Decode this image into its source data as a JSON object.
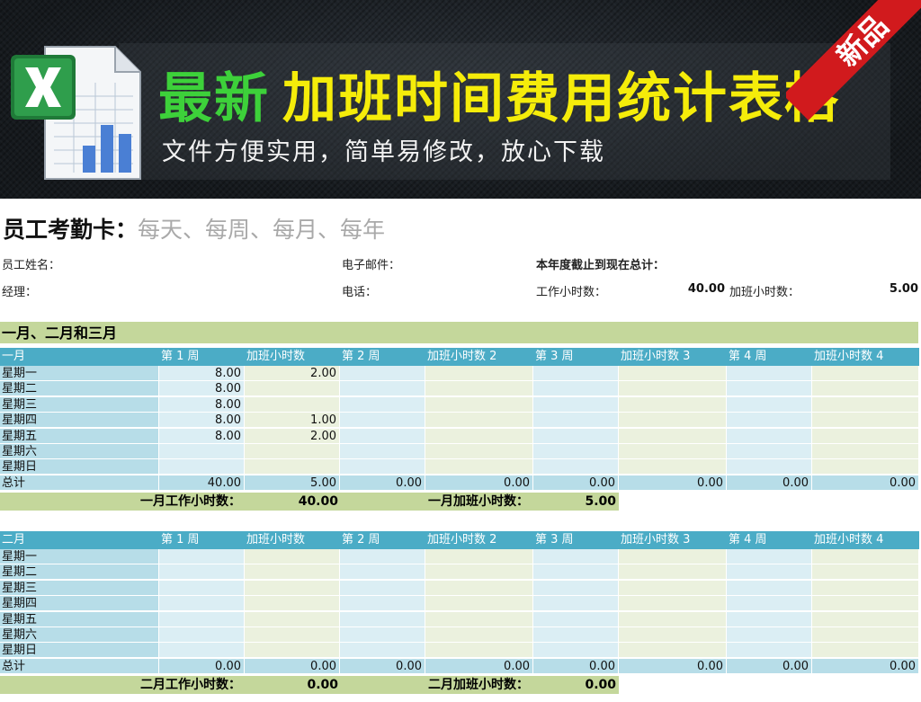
{
  "banner": {
    "title_green": "最新",
    "title_yellow": "加班时间费用统计表格",
    "subtitle": "文件方便实用，简单易修改，放心下载",
    "ribbon": "新品",
    "colors": {
      "green": "#3dd13a",
      "yellow": "#f5ec0a",
      "ribbon": "#d11a1d"
    }
  },
  "card": {
    "title": "员工考勤卡：",
    "subtitle": "每天、每周、每月、每年",
    "employee_label": "员工姓名：",
    "email_label": "电子邮件：",
    "ytd_label": "本年度截止到现在总计：",
    "manager_label": "经理：",
    "phone_label": "电话：",
    "work_hours_label": "工作小时数：",
    "work_hours_value": "40.00",
    "ot_hours_label": "加班小时数：",
    "ot_hours_value": "5.00"
  },
  "section": {
    "title": "一月、二月和三月"
  },
  "columns": [
    "第 1 周",
    "加班小时数",
    "第 2 周",
    "加班小时数 2",
    "第 3 周",
    "加班小时数 3",
    "第 4 周",
    "加班小时数 4"
  ],
  "days": [
    "星期一",
    "星期二",
    "星期三",
    "星期四",
    "星期五",
    "星期六",
    "星期日"
  ],
  "total_label": "总计",
  "months": [
    {
      "name": "一月",
      "rows": [
        [
          "8.00",
          "2.00",
          "",
          "",
          "",
          "",
          "",
          ""
        ],
        [
          "8.00",
          "",
          "",
          "",
          "",
          "",
          "",
          ""
        ],
        [
          "8.00",
          "",
          "",
          "",
          "",
          "",
          "",
          ""
        ],
        [
          "8.00",
          "1.00",
          "",
          "",
          "",
          "",
          "",
          ""
        ],
        [
          "8.00",
          "2.00",
          "",
          "",
          "",
          "",
          "",
          ""
        ],
        [
          "",
          "",
          "",
          "",
          "",
          "",
          "",
          ""
        ],
        [
          "",
          "",
          "",
          "",
          "",
          "",
          "",
          ""
        ]
      ],
      "totals": [
        "40.00",
        "5.00",
        "0.00",
        "0.00",
        "0.00",
        "0.00",
        "0.00",
        "0.00"
      ],
      "work_label": "一月工作小时数：",
      "work_value": "40.00",
      "ot_label": "一月加班小时数：",
      "ot_value": "5.00"
    },
    {
      "name": "二月",
      "rows": [
        [
          "",
          "",
          "",
          "",
          "",
          "",
          "",
          ""
        ],
        [
          "",
          "",
          "",
          "",
          "",
          "",
          "",
          ""
        ],
        [
          "",
          "",
          "",
          "",
          "",
          "",
          "",
          ""
        ],
        [
          "",
          "",
          "",
          "",
          "",
          "",
          "",
          ""
        ],
        [
          "",
          "",
          "",
          "",
          "",
          "",
          "",
          ""
        ],
        [
          "",
          "",
          "",
          "",
          "",
          "",
          "",
          ""
        ],
        [
          "",
          "",
          "",
          "",
          "",
          "",
          "",
          ""
        ]
      ],
      "totals": [
        "0.00",
        "0.00",
        "0.00",
        "0.00",
        "0.00",
        "0.00",
        "0.00",
        "0.00"
      ],
      "work_label": "二月工作小时数：",
      "work_value": "0.00",
      "ot_label": "二月加班小时数：",
      "ot_value": "0.00"
    }
  ]
}
